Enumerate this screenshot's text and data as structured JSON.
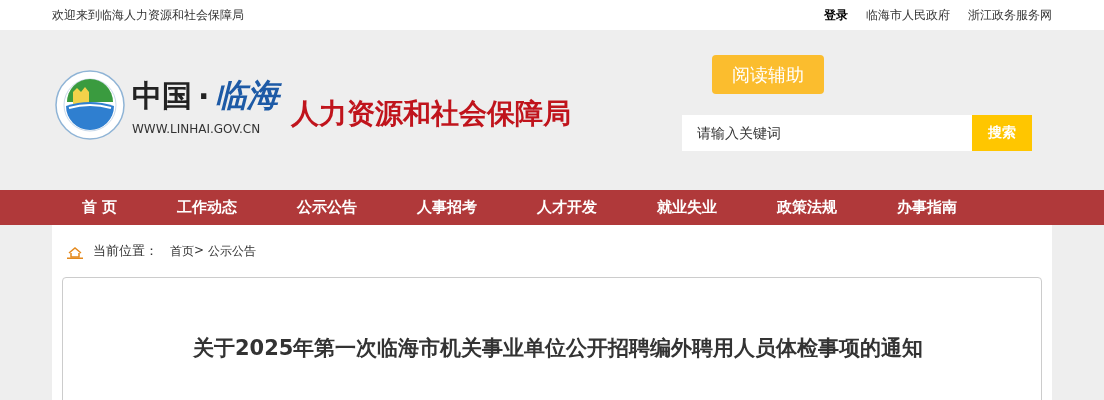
{
  "top_bar": {
    "welcome": "欢迎来到临海人力资源和社会保障局",
    "links": [
      {
        "label": "登录",
        "kind": "bold"
      },
      {
        "label": "临海市人民政府",
        "kind": "plain"
      },
      {
        "label": "浙江政务服务网",
        "kind": "plain"
      }
    ]
  },
  "header": {
    "logo": {
      "country": "中国",
      "dot": "·",
      "city": "临海",
      "url": "WWW.LINHAI.GOV.CN",
      "department": "人力资源和社会保障局"
    },
    "reading_aid_button": "阅读辅助",
    "search": {
      "placeholder": "请输入关键词",
      "button": "搜索"
    }
  },
  "nav": [
    {
      "label": "首 页"
    },
    {
      "label": "工作动态"
    },
    {
      "label": "公示公告"
    },
    {
      "label": "人事招考"
    },
    {
      "label": "人才开发"
    },
    {
      "label": "就业失业"
    },
    {
      "label": "政策法规"
    },
    {
      "label": "办事指南"
    }
  ],
  "breadcrumb": {
    "label": "当前位置：",
    "path": [
      {
        "label": "首页"
      },
      {
        "label": "公示公告"
      }
    ],
    "separator": ">"
  },
  "article": {
    "title": "关于2025年第一次临海市机关事业单位公开招聘编外聘用人员体检事项的通知"
  }
}
